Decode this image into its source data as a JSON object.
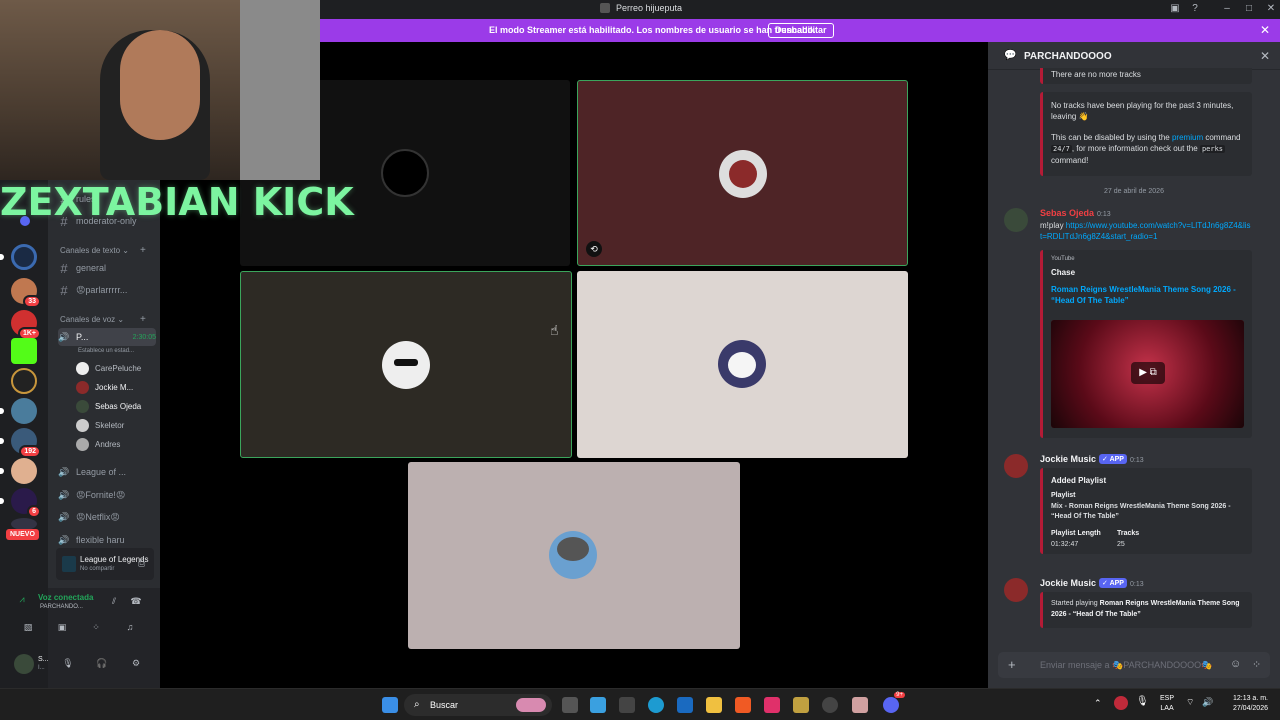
{
  "window": {
    "title": "Perreo hijueputa"
  },
  "banner": {
    "text": "El modo Streamer está habilitado. Los nombres de usuario se han truncado.",
    "button": "Deshabilitar"
  },
  "overlay": {
    "text": "ZEXTABIAN  KICK"
  },
  "servers": {
    "badges": [
      "33",
      "1K+",
      "192",
      "6"
    ],
    "new_label": "NUEVO"
  },
  "channels": {
    "partial_top": "rules",
    "moderator": "moderator-only",
    "text_category": "Canales de texto",
    "text_channels": [
      "general",
      "😡parlarrrrr..."
    ],
    "voice_category": "Canales de voz",
    "active_voice": {
      "name": "P...",
      "time": "2:30:05",
      "status": "Establece un estad..."
    },
    "members": [
      "CarePeluche",
      "Jockie M...",
      "Sebas Ojeda",
      "Skeletor",
      "Andres"
    ],
    "other_voice": [
      "League of ...",
      "😡Fornite!😡",
      "😡Netflix😡",
      "flexible haru"
    ]
  },
  "activity": {
    "game": "League of Legends",
    "status": "No compartir"
  },
  "voice_panel": {
    "status": "Voz conectada",
    "channel": "PARCHANDO..."
  },
  "user": {
    "name": "S...",
    "sub": "I..."
  },
  "chat": {
    "channel_name": "PARCHANDOOOO",
    "msg0_line": "There are no more tracks",
    "msg1_line1": "No tracks have been playing for the past 3 minutes, leaving 👋",
    "msg1_line2a": "This can be disabled by using the",
    "msg1_premium": "premium",
    "msg1_line2b": "command",
    "msg1_code1": "24/7",
    "msg1_line2c": ", for more information check out the",
    "msg1_code2": "perks",
    "msg1_line2d": "command!",
    "date_divider": "27 de abril de 2026",
    "msg2_user": "Sebas Ojeda",
    "msg2_time": "0:13",
    "msg2_text": "m!play",
    "msg2_link": "https://www.youtube.com/watch?v=LlTdJn6g8Z4&list=RDLlTdJn6g8Z4&start_radio=1",
    "embed_provider": "YouTube",
    "embed_author": "Chase",
    "embed_title": "Roman Reigns WrestleMania Theme Song 2026 - “Head Of The Table”",
    "msg3_user": "Jockie Music",
    "app_tag": "✓ APP",
    "msg3_time": "0:13",
    "added_title": "Added Playlist",
    "playlist_label": "Playlist",
    "playlist_value": "Mix - Roman Reigns WrestleMania Theme Song 2026 - “Head Of The Table”",
    "length_label": "Playlist Length",
    "length_value": "01:32:47",
    "tracks_label": "Tracks",
    "tracks_value": "25",
    "msg4_user": "Jockie Music",
    "msg4_time": "0:13",
    "started_a": "Started playing",
    "started_b": "Roman Reigns WrestleMania Theme Song 2026 - “Head Of The Table”",
    "composer_placeholder": "Enviar mensaje a 🎭PARCHANDOOOO🎭"
  },
  "taskbar": {
    "search": "Buscar",
    "lang1": "ESP",
    "lang2": "LAA",
    "time": "12:13 a. m.",
    "date": "27/04/2026",
    "discord_badge": "9+"
  },
  "colors": {
    "banner": "#9b3be8",
    "embed_border": "#b41b36",
    "link": "#00a8fc",
    "voice_green": "#23a55a",
    "app_tag": "#5865f2"
  }
}
